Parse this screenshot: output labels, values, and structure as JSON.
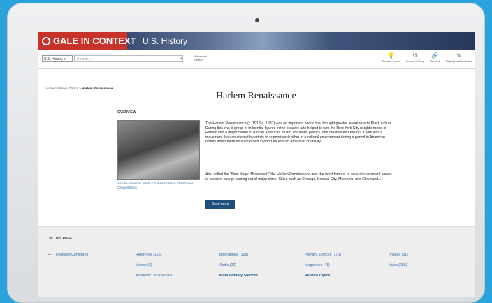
{
  "app": {
    "brand": "GALE IN CONTEXT",
    "product": "U.S. History"
  },
  "toolbar": {
    "select_value": "U.S. History",
    "search_placeholder": "Search...",
    "advanced": "Advanced Search",
    "tools": [
      {
        "label": "Browse Topics",
        "icon": "lightbulb-icon"
      },
      {
        "label": "Search History",
        "icon": "history-icon"
      },
      {
        "label": "Get Link",
        "icon": "link-icon"
      },
      {
        "label": "Highlights And Notes",
        "icon": "pen-icon"
      }
    ]
  },
  "breadcrumb": {
    "trail": "Home > Browse Topics > ",
    "current": "Harlem Renaissance"
  },
  "page": {
    "title": "Harlem Renaissance",
    "overview_label": "OVERVIEW",
    "image_caption": "African-American Poets Countee Cullen & Christopher Caswell Moss",
    "paragraph1": "The Harlem Renaissance (c. 1918-c. 1937) was an important period that brought greater awareness to Black culture. During this era, a group of influential figures in the creative arts helped to turn the New York City neighborhood of Harlem into a major center of African American music, literature, politics, and creative expression. It was less a movement than an attempt by artists to support each other in a cultural environment during a period in American history when there was not broad support for African American creativity.",
    "paragraph2": "Also called the \"New Negro Movement,\" the Harlem Renaissance was the most famous of several concurrent waves of creative energy coming out of major cities. Cities such as Chicago, Kansas City, Memphis, and Cleveland...",
    "read_more": "Read more"
  },
  "on_this_page": {
    "label": "ON THIS PAGE",
    "links": {
      "featured": "Featured Content (8)",
      "reference": "Reference (166)",
      "videos": "Videos (6)",
      "academic": "Academic Journals (61)",
      "biographies": "Biographies (158)",
      "audio": "Audio (22)",
      "more_primary": "More Primary Sources",
      "primary": "Primary Sources (170)",
      "magazines": "Magazines (41)",
      "related": "Related Topics",
      "images": "Images (81)",
      "news": "News (286)"
    }
  }
}
